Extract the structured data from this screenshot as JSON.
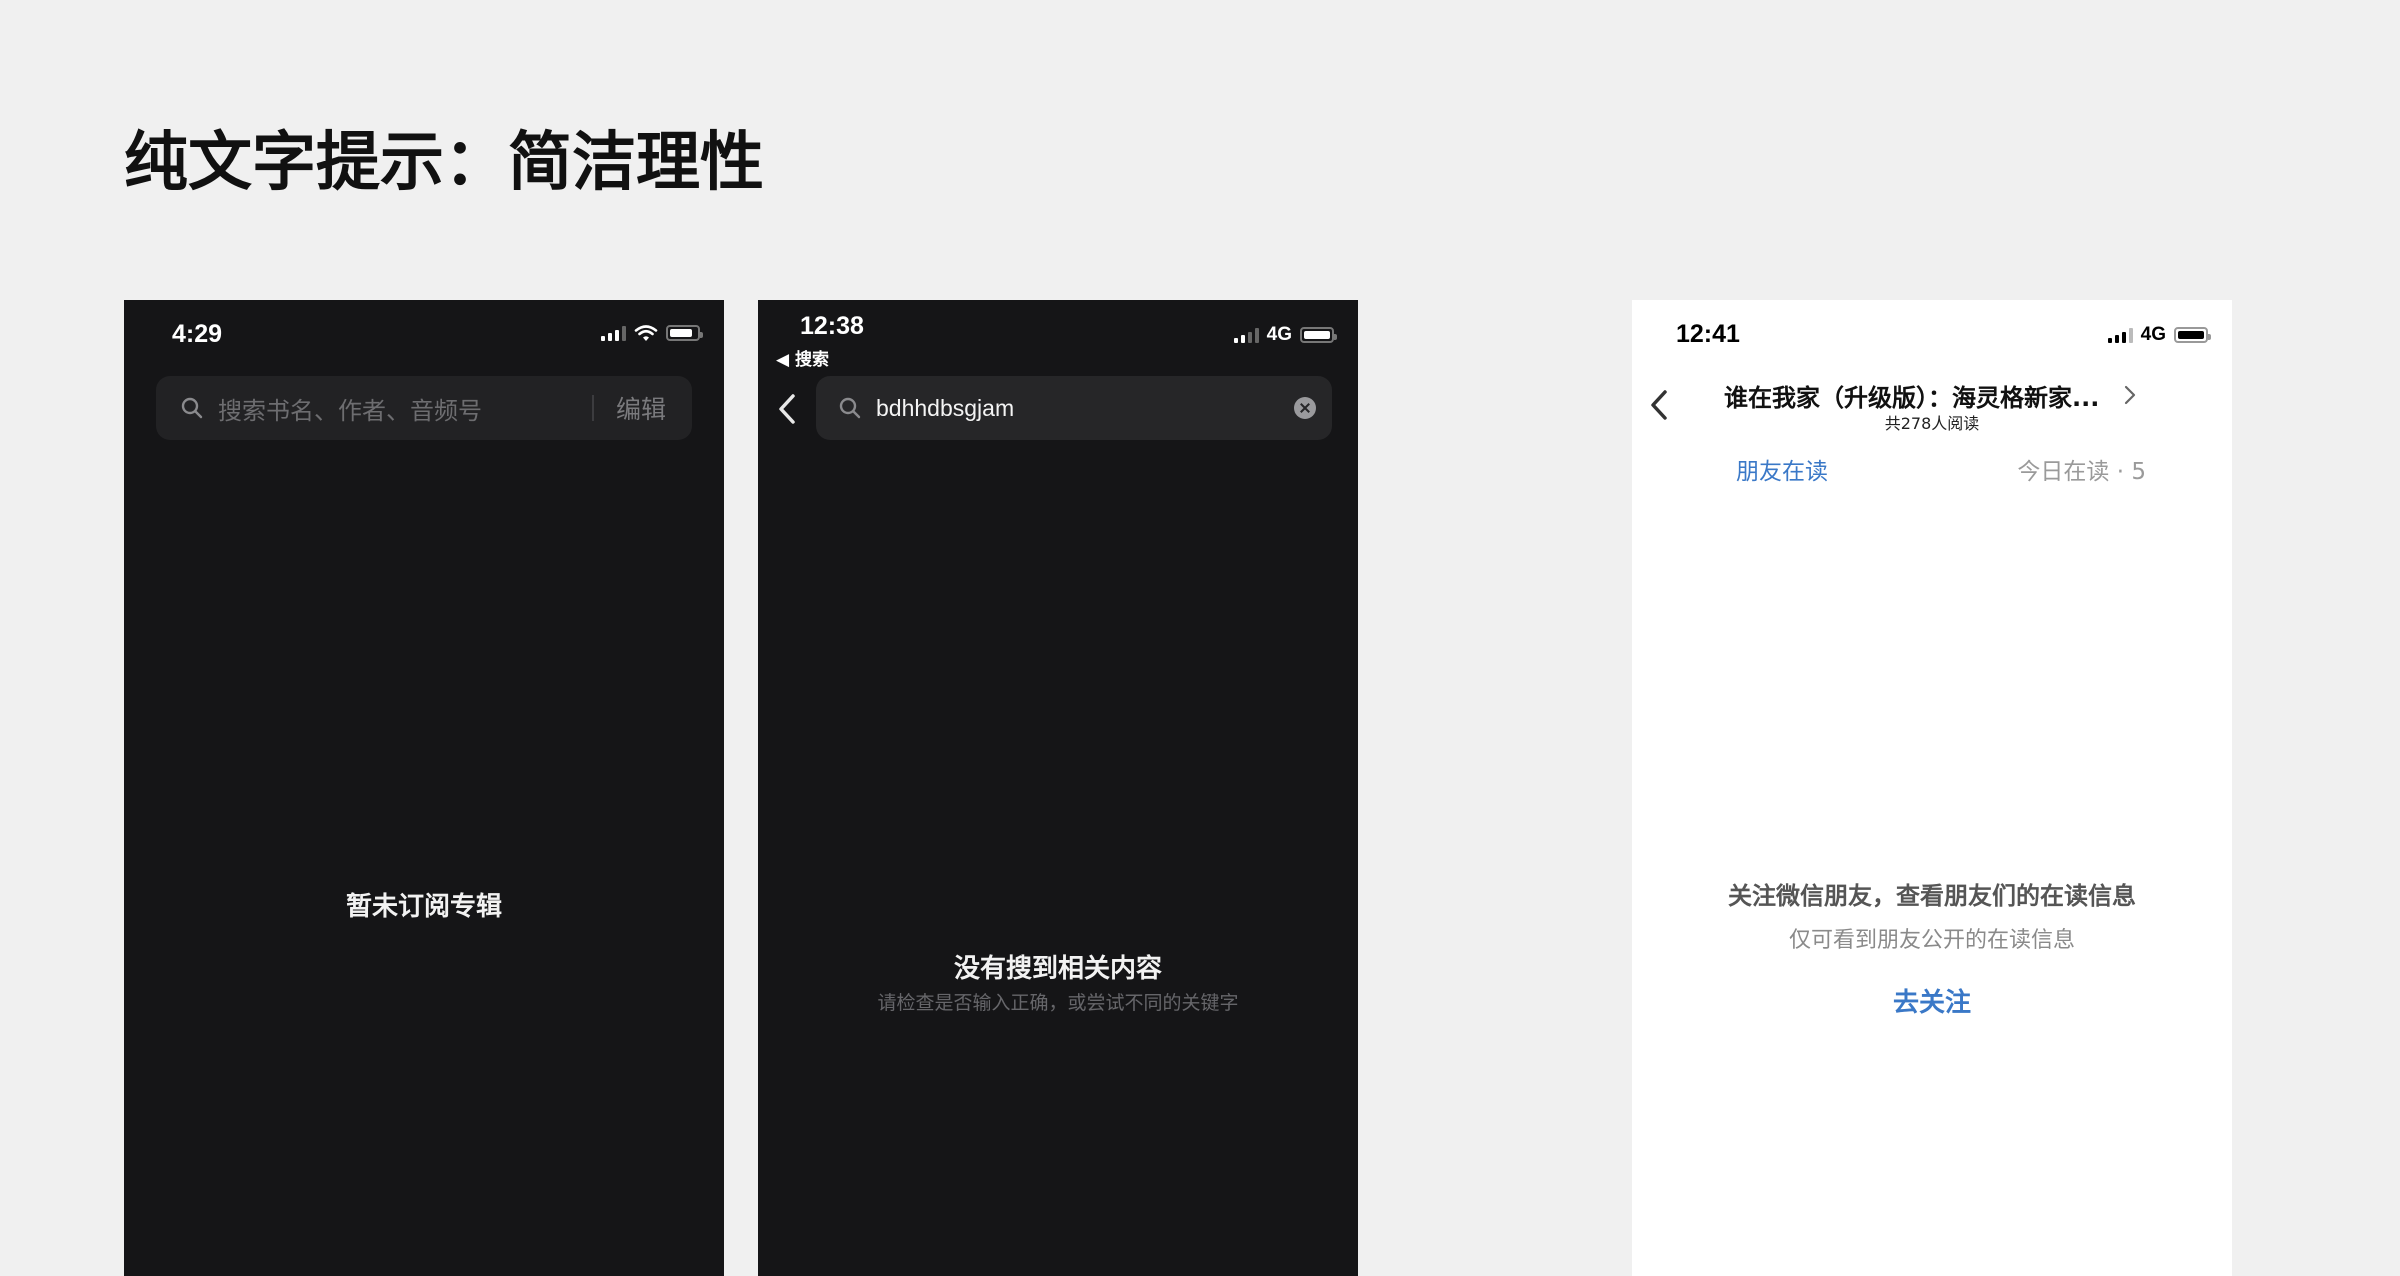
{
  "heading": "纯文字提示：简洁理性",
  "phones": [
    {
      "theme": "dark",
      "status": {
        "time": "4:29",
        "network": ""
      },
      "search": {
        "placeholder": "搜索书名、作者、音频号",
        "edit_label": "编辑"
      },
      "empty_state": {
        "title": "暂未订阅专辑"
      }
    },
    {
      "theme": "dark",
      "status": {
        "time": "12:38",
        "network": "4G"
      },
      "back_link": "◀ 搜索",
      "search": {
        "query": "bdhhdbsgjam"
      },
      "empty_state": {
        "title": "没有搜到相关内容",
        "subtitle": "请检查是否输入正确，或尝试不同的关键字"
      }
    },
    {
      "theme": "light",
      "status": {
        "time": "12:41",
        "network": "4G"
      },
      "header": {
        "title": "谁在我家（升级版）：海灵格新家...",
        "readers": "共278人阅读"
      },
      "tabs": {
        "friends": "朋友在读",
        "today": "今日在读 · 5"
      },
      "prompt": {
        "title": "关注微信朋友，查看朋友们的在读信息",
        "subtitle": "仅可看到朋友公开的在读信息",
        "action": "去关注"
      }
    }
  ],
  "colors": {
    "page_bg": "#f0f0f0",
    "dark_bg": "#151517",
    "light_bg": "#ffffff",
    "accent_blue": "#3a78c7"
  }
}
